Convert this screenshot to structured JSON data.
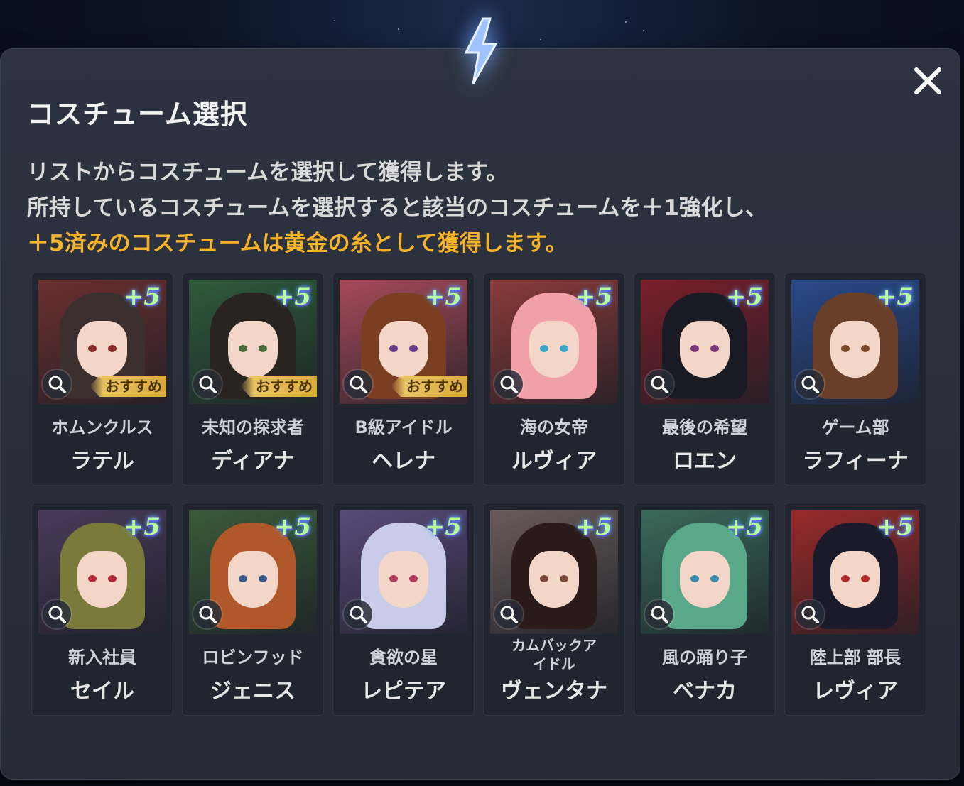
{
  "dialog": {
    "title": "コスチューム選択",
    "desc_line1": "リストからコスチュームを選択して獲得します。",
    "desc_line2": "所持しているコスチュームを選択すると該当のコスチュームを＋1強化し、",
    "desc_line3": "＋5済みのコスチュームは黄金の糸として獲得します。",
    "close_icon": "close-icon",
    "highlight_color": "#f6b32a"
  },
  "cards": [
    {
      "badge": "+5",
      "title": "ホムンクルス",
      "name": "ラテル",
      "recommended": "おすすめ",
      "bg": "#6b2f2f",
      "hair": "#3b2f2f",
      "eye": "#8a2b2b"
    },
    {
      "badge": "+5",
      "title": "未知の探求者",
      "name": "ディアナ",
      "recommended": "おすすめ",
      "bg": "#2f5a3a",
      "hair": "#2a2420",
      "eye": "#4a6b3a"
    },
    {
      "badge": "+5",
      "title": "B級アイドル",
      "name": "ヘレナ",
      "recommended": "おすすめ",
      "bg": "#a84a5a",
      "hair": "#7a3e22",
      "eye": "#6a3a8a"
    },
    {
      "badge": "+5",
      "title": "海の女帝",
      "name": "ルヴィア",
      "recommended": "",
      "bg": "#8a3a3a",
      "hair": "#f2a0a8",
      "eye": "#3aa8c8"
    },
    {
      "badge": "+5",
      "title": "最後の希望",
      "name": "ロエン",
      "recommended": "",
      "bg": "#7a1f2a",
      "hair": "#1a1a24",
      "eye": "#7a3a7a"
    },
    {
      "badge": "+5",
      "title": "ゲーム部",
      "name": "ラフィーナ",
      "recommended": "",
      "bg": "#2a4a8a",
      "hair": "#6a3f2a",
      "eye": "#7a4a2a"
    },
    {
      "badge": "+5",
      "title": "新入社員",
      "name": "セイル",
      "recommended": "",
      "bg": "#4a3a5a",
      "hair": "#7a7a3a",
      "eye": "#b02a3a"
    },
    {
      "badge": "+5",
      "title": "ロビンフッド",
      "name": "ジェニス",
      "recommended": "",
      "bg": "#3a5a3a",
      "hair": "#b0582a",
      "eye": "#3a5a8a"
    },
    {
      "badge": "+5",
      "title": "貪欲の星",
      "name": "レピテア",
      "recommended": "",
      "bg": "#5a4a7a",
      "hair": "#c8cce8",
      "eye": "#b03a5a"
    },
    {
      "badge": "+5",
      "title": "カムバックア\nイドル",
      "name": "ヴェンタナ",
      "recommended": "",
      "bg": "#6a5a5a",
      "hair": "#2a1a1a",
      "eye": "#7a4a3a"
    },
    {
      "badge": "+5",
      "title": "風の踊り子",
      "name": "ベナカ",
      "recommended": "",
      "bg": "#3a6a5a",
      "hair": "#5aa88a",
      "eye": "#3a8ab0"
    },
    {
      "badge": "+5",
      "title": "陸上部 部長",
      "name": "レヴィア",
      "recommended": "",
      "bg": "#9a2a2a",
      "hair": "#1a1a2a",
      "eye": "#b02a2a"
    }
  ]
}
